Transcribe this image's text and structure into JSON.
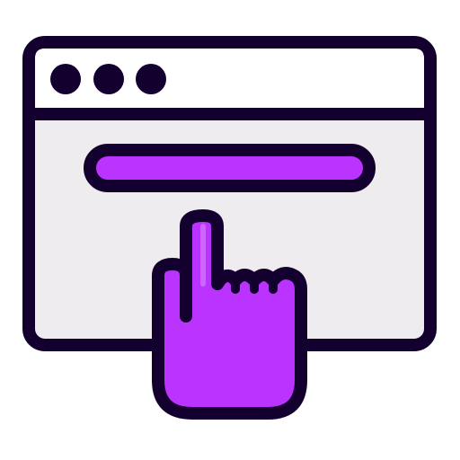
{
  "icon": {
    "name": "click-browser-icon",
    "parts": [
      "browser-window-icon",
      "window-control-dots",
      "address-bar",
      "pointing-hand-icon"
    ]
  },
  "colors": {
    "outline": "#14002e",
    "window_top": "#ffffff",
    "window_body": "#efecf0",
    "accent": "#bb33ff",
    "background": "#ffffff"
  }
}
